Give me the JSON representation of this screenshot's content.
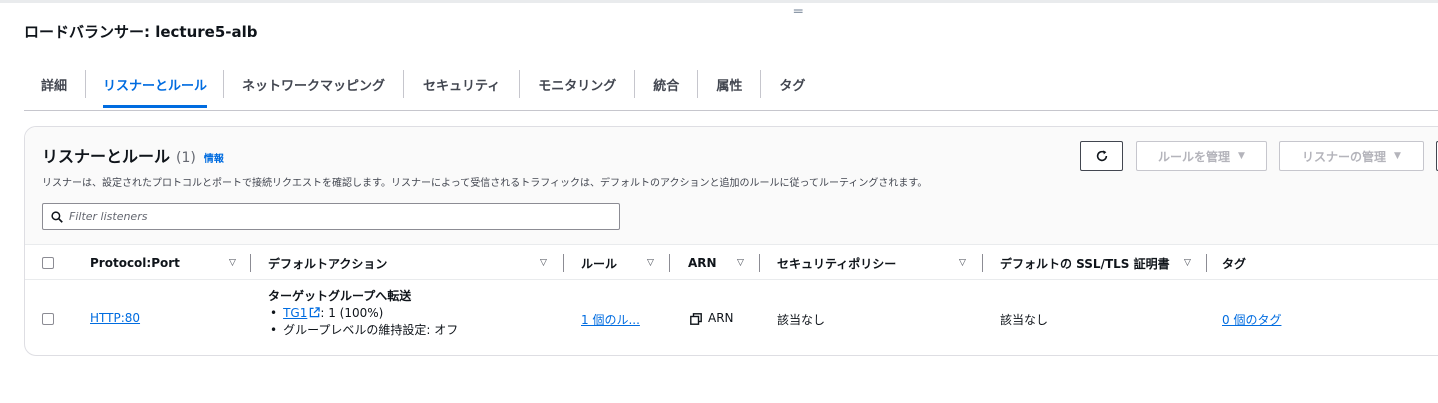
{
  "page": {
    "title": "ロードバランサー: lecture5-alb"
  },
  "tabs": [
    {
      "label": "詳細",
      "active": false
    },
    {
      "label": "リスナーとルール",
      "active": true
    },
    {
      "label": "ネットワークマッピング",
      "active": false
    },
    {
      "label": "セキュリティ",
      "active": false
    },
    {
      "label": "モニタリング",
      "active": false
    },
    {
      "label": "統合",
      "active": false
    },
    {
      "label": "属性",
      "active": false
    },
    {
      "label": "タグ",
      "active": false
    }
  ],
  "panel": {
    "title": "リスナーとルール",
    "count": "(1)",
    "info_link": "情報",
    "description": "リスナーは、設定されたプロトコルとポートで接続リクエストを確認します。リスナーによって受信されるトラフィックは、デフォルトのアクションと追加のルールに従ってルーティングされます。",
    "buttons": {
      "manage_rules": "ルールを管理",
      "manage_listener": "リスナーの管理"
    },
    "search": {
      "placeholder": "Filter listeners",
      "value": ""
    }
  },
  "table": {
    "columns": [
      "Protocol:Port",
      "デフォルトアクション",
      "ルール",
      "ARN",
      "セキュリティポリシー",
      "デフォルトの SSL/TLS 証明書",
      "タグ"
    ],
    "rows": [
      {
        "protocol_port": "HTTP:80",
        "default_action": {
          "title": "ターゲットグループへ転送",
          "target_group": "TG1",
          "target_weight": ": 1 (100%)",
          "stickiness": "グループレベルの維持設定: オフ"
        },
        "rules": "1 個のル...",
        "arn": "ARN",
        "security_policy": "該当なし",
        "ssl_cert": "該当なし",
        "tags": "0 個のタグ"
      }
    ]
  },
  "icons": {
    "refresh": "refresh-icon",
    "search": "search-icon",
    "external": "external-link-icon",
    "copy": "copy-icon",
    "dropdown": "caret-down-icon",
    "sort": "sort-caret-icon"
  },
  "colors": {
    "accent": "#006ce0",
    "text": "#0f141a",
    "disabled": "#b4b4bb",
    "border": "#c6c6cd"
  }
}
